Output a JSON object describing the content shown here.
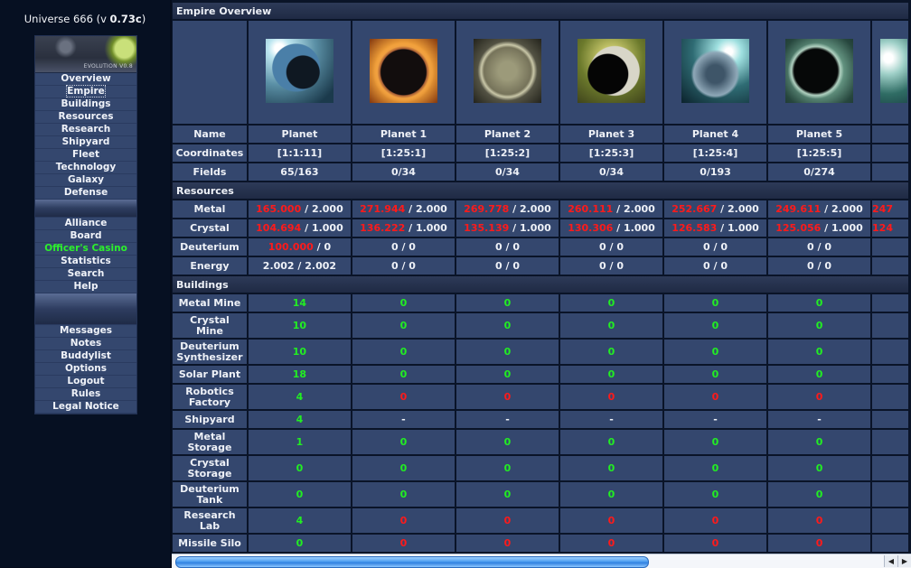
{
  "sidebar": {
    "universe_name": "Universe 666",
    "version_prefix": "(v ",
    "version": "0.73c",
    "version_suffix": ")",
    "banner_text": "EVOLUTION V0.8",
    "group1": [
      "Overview",
      "Empire",
      "Buildings",
      "Resources",
      "Research",
      "Shipyard",
      "Fleet",
      "Technology",
      "Galaxy",
      "Defense"
    ],
    "group2": [
      "Alliance",
      "Board",
      "Officer's Casino",
      "Statistics",
      "Search",
      "Help"
    ],
    "group3": [
      "Messages",
      "Notes",
      "Buddylist",
      "Options",
      "Logout",
      "Rules",
      "Legal Notice"
    ],
    "active_item": "Empire",
    "highlight_item": "Officer's Casino"
  },
  "main": {
    "title": "Empire Overview",
    "labels": {
      "name": "Name",
      "coordinates": "Coordinates",
      "fields": "Fields",
      "resources": "Resources",
      "buildings": "Buildings"
    },
    "planets": [
      {
        "image": "planet-image-blue",
        "name": "Planet",
        "coordinates": "[1:1:11]",
        "fields": "65/163"
      },
      {
        "image": "planet-image-orange",
        "name": "Planet 1",
        "coordinates": "[1:25:1]",
        "fields": "0/34"
      },
      {
        "image": "planet-image-beige",
        "name": "Planet 2",
        "coordinates": "[1:25:2]",
        "fields": "0/34"
      },
      {
        "image": "planet-image-yellow-green",
        "name": "Planet 3",
        "coordinates": "[1:25:3]",
        "fields": "0/34"
      },
      {
        "image": "planet-image-teal",
        "name": "Planet 4",
        "coordinates": "[1:25:4]",
        "fields": "0/193"
      },
      {
        "image": "planet-image-green-dark",
        "name": "Planet 5",
        "coordinates": "[1:25:5]",
        "fields": "0/274"
      },
      {
        "image": "planet-image-partial",
        "name": "",
        "coordinates": "",
        "fields": ""
      }
    ],
    "resources": [
      {
        "label": "Metal",
        "values": [
          {
            "amount": "165.000",
            "cap": "2.000",
            "over": true
          },
          {
            "amount": "271.944",
            "cap": "2.000",
            "over": true
          },
          {
            "amount": "269.778",
            "cap": "2.000",
            "over": true
          },
          {
            "amount": "260.111",
            "cap": "2.000",
            "over": true
          },
          {
            "amount": "252.667",
            "cap": "2.000",
            "over": true
          },
          {
            "amount": "249.611",
            "cap": "2.000",
            "over": true
          },
          {
            "amount": "247",
            "cap": "",
            "over": true
          }
        ]
      },
      {
        "label": "Crystal",
        "values": [
          {
            "amount": "104.694",
            "cap": "1.000",
            "over": true
          },
          {
            "amount": "136.222",
            "cap": "1.000",
            "over": true
          },
          {
            "amount": "135.139",
            "cap": "1.000",
            "over": true
          },
          {
            "amount": "130.306",
            "cap": "1.000",
            "over": true
          },
          {
            "amount": "126.583",
            "cap": "1.000",
            "over": true
          },
          {
            "amount": "125.056",
            "cap": "1.000",
            "over": true
          },
          {
            "amount": "124",
            "cap": "",
            "over": true
          }
        ]
      },
      {
        "label": "Deuterium",
        "values": [
          {
            "amount": "100.000",
            "cap": "0",
            "over": true
          },
          {
            "amount": "0",
            "cap": "0",
            "over": false
          },
          {
            "amount": "0",
            "cap": "0",
            "over": false
          },
          {
            "amount": "0",
            "cap": "0",
            "over": false
          },
          {
            "amount": "0",
            "cap": "0",
            "over": false
          },
          {
            "amount": "0",
            "cap": "0",
            "over": false
          },
          {
            "amount": "",
            "cap": "",
            "over": false
          }
        ]
      },
      {
        "label": "Energy",
        "values": [
          {
            "amount": "2.002",
            "cap": "2.002",
            "over": false
          },
          {
            "amount": "0",
            "cap": "0",
            "over": false
          },
          {
            "amount": "0",
            "cap": "0",
            "over": false
          },
          {
            "amount": "0",
            "cap": "0",
            "over": false
          },
          {
            "amount": "0",
            "cap": "0",
            "over": false
          },
          {
            "amount": "0",
            "cap": "0",
            "over": false
          },
          {
            "amount": "",
            "cap": "",
            "over": false
          }
        ]
      }
    ],
    "buildings": [
      {
        "label": "Metal Mine",
        "levels": [
          [
            "14",
            "green"
          ],
          [
            "0",
            "green"
          ],
          [
            "0",
            "green"
          ],
          [
            "0",
            "green"
          ],
          [
            "0",
            "green"
          ],
          [
            "0",
            "green"
          ],
          [
            "",
            ""
          ]
        ]
      },
      {
        "label": "Crystal Mine",
        "levels": [
          [
            "10",
            "green"
          ],
          [
            "0",
            "green"
          ],
          [
            "0",
            "green"
          ],
          [
            "0",
            "green"
          ],
          [
            "0",
            "green"
          ],
          [
            "0",
            "green"
          ],
          [
            "",
            ""
          ]
        ]
      },
      {
        "label": "Deuterium Synthesizer",
        "levels": [
          [
            "10",
            "green"
          ],
          [
            "0",
            "green"
          ],
          [
            "0",
            "green"
          ],
          [
            "0",
            "green"
          ],
          [
            "0",
            "green"
          ],
          [
            "0",
            "green"
          ],
          [
            "",
            ""
          ]
        ]
      },
      {
        "label": "Solar Plant",
        "levels": [
          [
            "18",
            "green"
          ],
          [
            "0",
            "green"
          ],
          [
            "0",
            "green"
          ],
          [
            "0",
            "green"
          ],
          [
            "0",
            "green"
          ],
          [
            "0",
            "green"
          ],
          [
            "",
            ""
          ]
        ]
      },
      {
        "label": "Robotics Factory",
        "levels": [
          [
            "4",
            "green"
          ],
          [
            "0",
            "red"
          ],
          [
            "0",
            "red"
          ],
          [
            "0",
            "red"
          ],
          [
            "0",
            "red"
          ],
          [
            "0",
            "red"
          ],
          [
            "",
            ""
          ]
        ]
      },
      {
        "label": "Shipyard",
        "levels": [
          [
            "4",
            "green"
          ],
          [
            "-",
            "white"
          ],
          [
            "-",
            "white"
          ],
          [
            "-",
            "white"
          ],
          [
            "-",
            "white"
          ],
          [
            "-",
            "white"
          ],
          [
            "",
            ""
          ]
        ]
      },
      {
        "label": "Metal Storage",
        "levels": [
          [
            "1",
            "green"
          ],
          [
            "0",
            "green"
          ],
          [
            "0",
            "green"
          ],
          [
            "0",
            "green"
          ],
          [
            "0",
            "green"
          ],
          [
            "0",
            "green"
          ],
          [
            "",
            ""
          ]
        ]
      },
      {
        "label": "Crystal Storage",
        "levels": [
          [
            "0",
            "green"
          ],
          [
            "0",
            "green"
          ],
          [
            "0",
            "green"
          ],
          [
            "0",
            "green"
          ],
          [
            "0",
            "green"
          ],
          [
            "0",
            "green"
          ],
          [
            "",
            ""
          ]
        ]
      },
      {
        "label": "Deuterium Tank",
        "levels": [
          [
            "0",
            "green"
          ],
          [
            "0",
            "green"
          ],
          [
            "0",
            "green"
          ],
          [
            "0",
            "green"
          ],
          [
            "0",
            "green"
          ],
          [
            "0",
            "green"
          ],
          [
            "",
            ""
          ]
        ]
      },
      {
        "label": "Research Lab",
        "levels": [
          [
            "4",
            "green"
          ],
          [
            "0",
            "red"
          ],
          [
            "0",
            "red"
          ],
          [
            "0",
            "red"
          ],
          [
            "0",
            "red"
          ],
          [
            "0",
            "red"
          ],
          [
            "",
            ""
          ]
        ]
      },
      {
        "label": "Missile Silo",
        "levels": [
          [
            "0",
            "green"
          ],
          [
            "0",
            "red"
          ],
          [
            "0",
            "red"
          ],
          [
            "0",
            "red"
          ],
          [
            "0",
            "red"
          ],
          [
            "0",
            "red"
          ],
          [
            "",
            ""
          ]
        ]
      }
    ],
    "two_line_labels": [
      "Crystal Mine",
      "Deuterium Synthesizer",
      "Robotics Factory",
      "Metal Storage",
      "Crystal Storage",
      "Deuterium Tank",
      "Research Lab"
    ]
  },
  "scrollbar": {
    "left_arrow": "◀",
    "right_arrow": "▶",
    "position_percent": 0
  }
}
